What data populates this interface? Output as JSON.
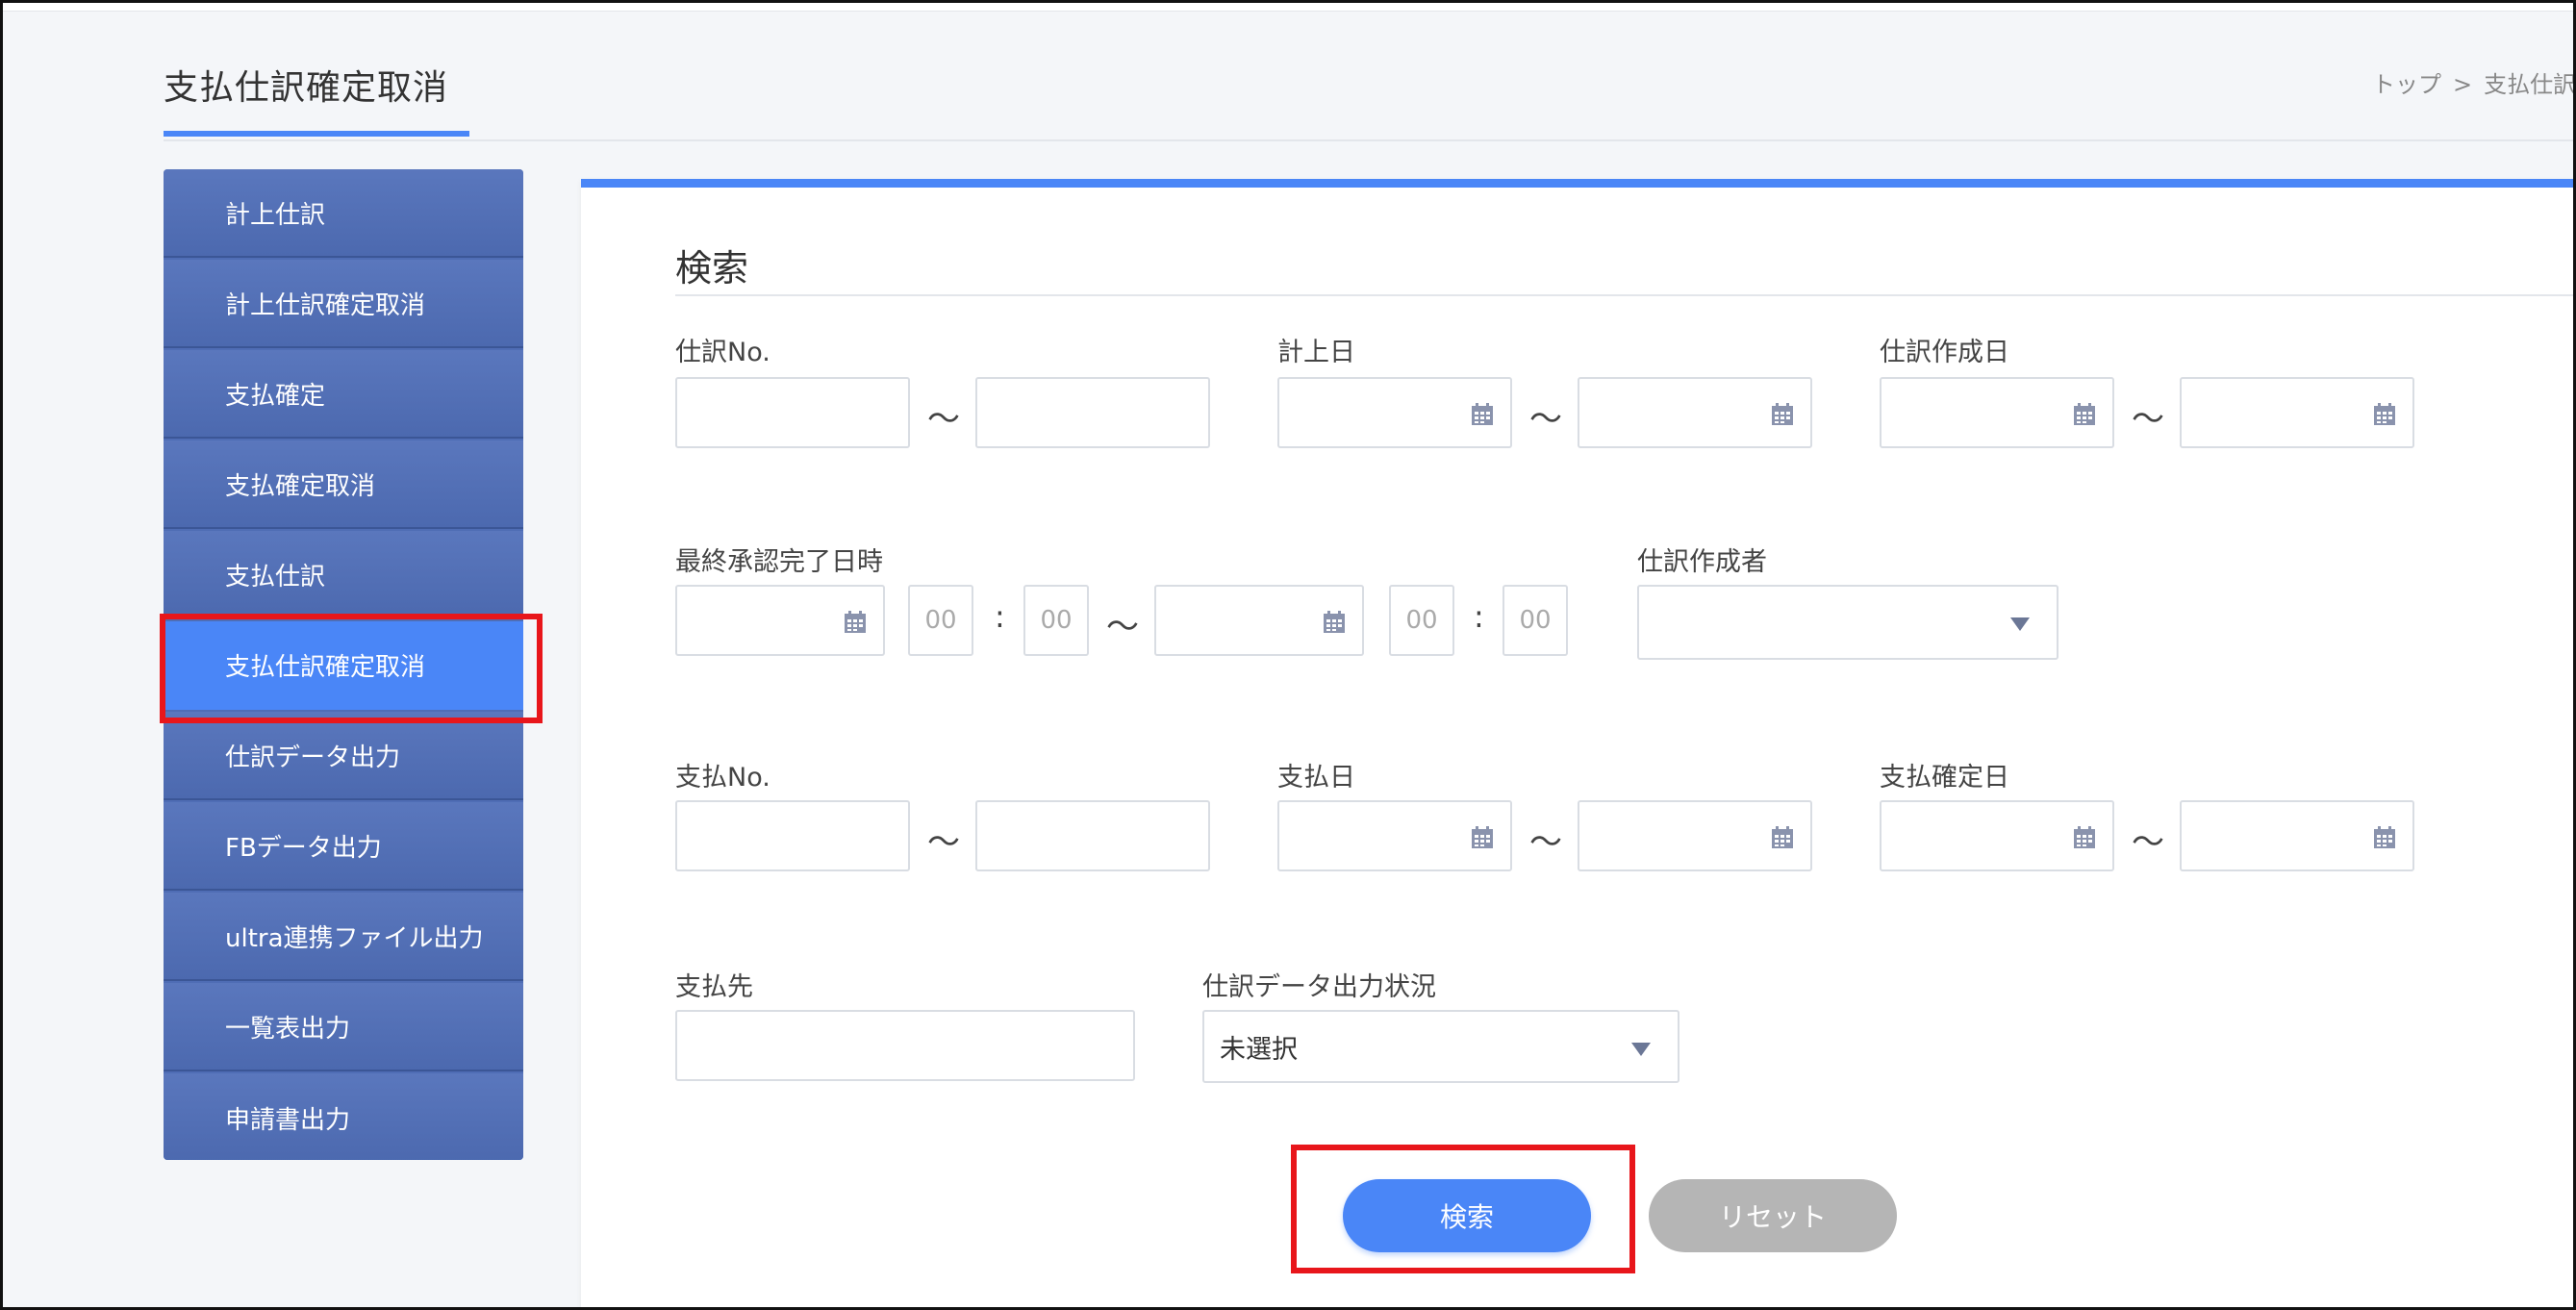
{
  "page": {
    "title": "支払仕訳確定取消",
    "breadcrumb": [
      "トップ",
      ">",
      "支払仕訳"
    ]
  },
  "sidebar": {
    "items": [
      {
        "label": "計上仕訳"
      },
      {
        "label": "計上仕訳確定取消"
      },
      {
        "label": "支払確定"
      },
      {
        "label": "支払確定取消"
      },
      {
        "label": "支払仕訳"
      },
      {
        "label": "支払仕訳確定取消",
        "active": true
      },
      {
        "label": "仕訳データ出力"
      },
      {
        "label": "FBデータ出力"
      },
      {
        "label": "ultra連携ファイル出力"
      },
      {
        "label": "一覧表出力"
      },
      {
        "label": "申請書出力"
      }
    ]
  },
  "search": {
    "title": "検索",
    "tilde": "～",
    "colon": ":",
    "fields": {
      "journal_no": {
        "label": "仕訳No.",
        "from": "",
        "to": ""
      },
      "posting_date": {
        "label": "計上日",
        "from": "",
        "to": ""
      },
      "journal_created_date": {
        "label": "仕訳作成日",
        "from": "",
        "to": ""
      },
      "final_approval": {
        "label": "最終承認完了日時",
        "from_date": "",
        "from_hour": "00",
        "from_min": "00",
        "to_date": "",
        "to_hour": "00",
        "to_min": "00"
      },
      "journal_creator": {
        "label": "仕訳作成者",
        "value": ""
      },
      "payment_no": {
        "label": "支払No.",
        "from": "",
        "to": ""
      },
      "payment_date": {
        "label": "支払日",
        "from": "",
        "to": ""
      },
      "payment_confirmed_date": {
        "label": "支払確定日",
        "from": "",
        "to": ""
      },
      "payee": {
        "label": "支払先",
        "value": ""
      },
      "journal_output_status": {
        "label": "仕訳データ出力状況",
        "value": "未選択"
      }
    },
    "buttons": {
      "search": "検索",
      "reset": "リセット"
    }
  },
  "colors": {
    "accent": "#4a86f7",
    "sidebar": "#4f6db5",
    "highlight": "#e8161b",
    "reset": "#b5b5b5"
  }
}
